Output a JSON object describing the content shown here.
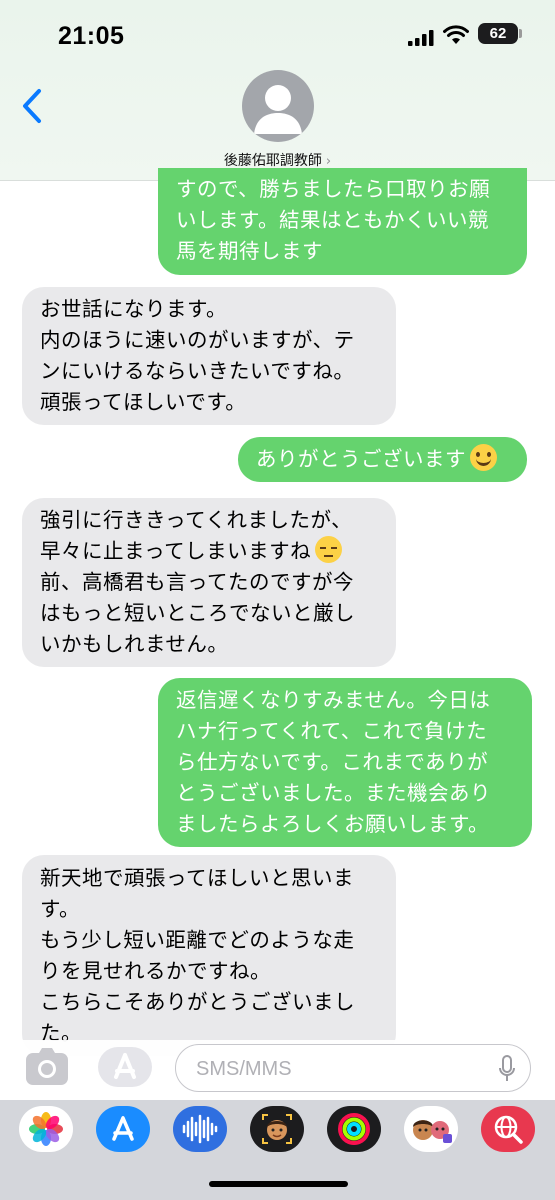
{
  "status": {
    "time": "21:05",
    "battery": "62"
  },
  "header": {
    "contact_name": "後藤佑耶調教師",
    "chevron": "›"
  },
  "messages": [
    {
      "from": "me",
      "lines": [
        "すので、勝ちましたら口取りお願",
        "いします。結果はともかくいい競",
        "馬を期待します"
      ]
    },
    {
      "from": "them",
      "lines": [
        "お世話になります。",
        "内のほうに速いのがいますが、テ",
        "ンにいけるならいきたいですね。",
        "頑張ってほしいです。"
      ]
    },
    {
      "from": "me",
      "lines": [
        "ありがとうございます"
      ],
      "emoji": "smiling-face-emoji"
    },
    {
      "from": "them",
      "lines": [
        "強引に行ききってくれましたが、",
        "早々に止まってしまいますね",
        "前、高橋君も言ってたのですが今",
        "はもっと短いところでないと厳し",
        "いかもしれません。"
      ],
      "emoji": "pensive-face-emoji"
    },
    {
      "from": "me",
      "lines": [
        "返信遅くなりすみません。今日は",
        "ハナ行ってくれて、これで負けた",
        "ら仕方ないです。これまでありが",
        "とうございました。また機会あり",
        "ましたらよろしくお願いします。"
      ]
    },
    {
      "from": "them",
      "lines": [
        "新天地で頑張ってほしいと思いま",
        "す。",
        "もう少し短い距離でどのような走",
        "りを見せれるかですね。",
        "こちらこそありがとうございまし",
        "た。"
      ]
    }
  ],
  "composer": {
    "placeholder": "SMS/MMS"
  },
  "app_drawer": [
    "photos-app-icon",
    "app-store-app-icon",
    "audio-messages-app-icon",
    "memoji-app-icon",
    "activity-app-icon",
    "memoji-stickers-app-icon",
    "web-images-app-icon"
  ],
  "colors": {
    "outgoing": "#65d36e",
    "incoming": "#e9e9eb",
    "accent": "#0a7aff"
  }
}
